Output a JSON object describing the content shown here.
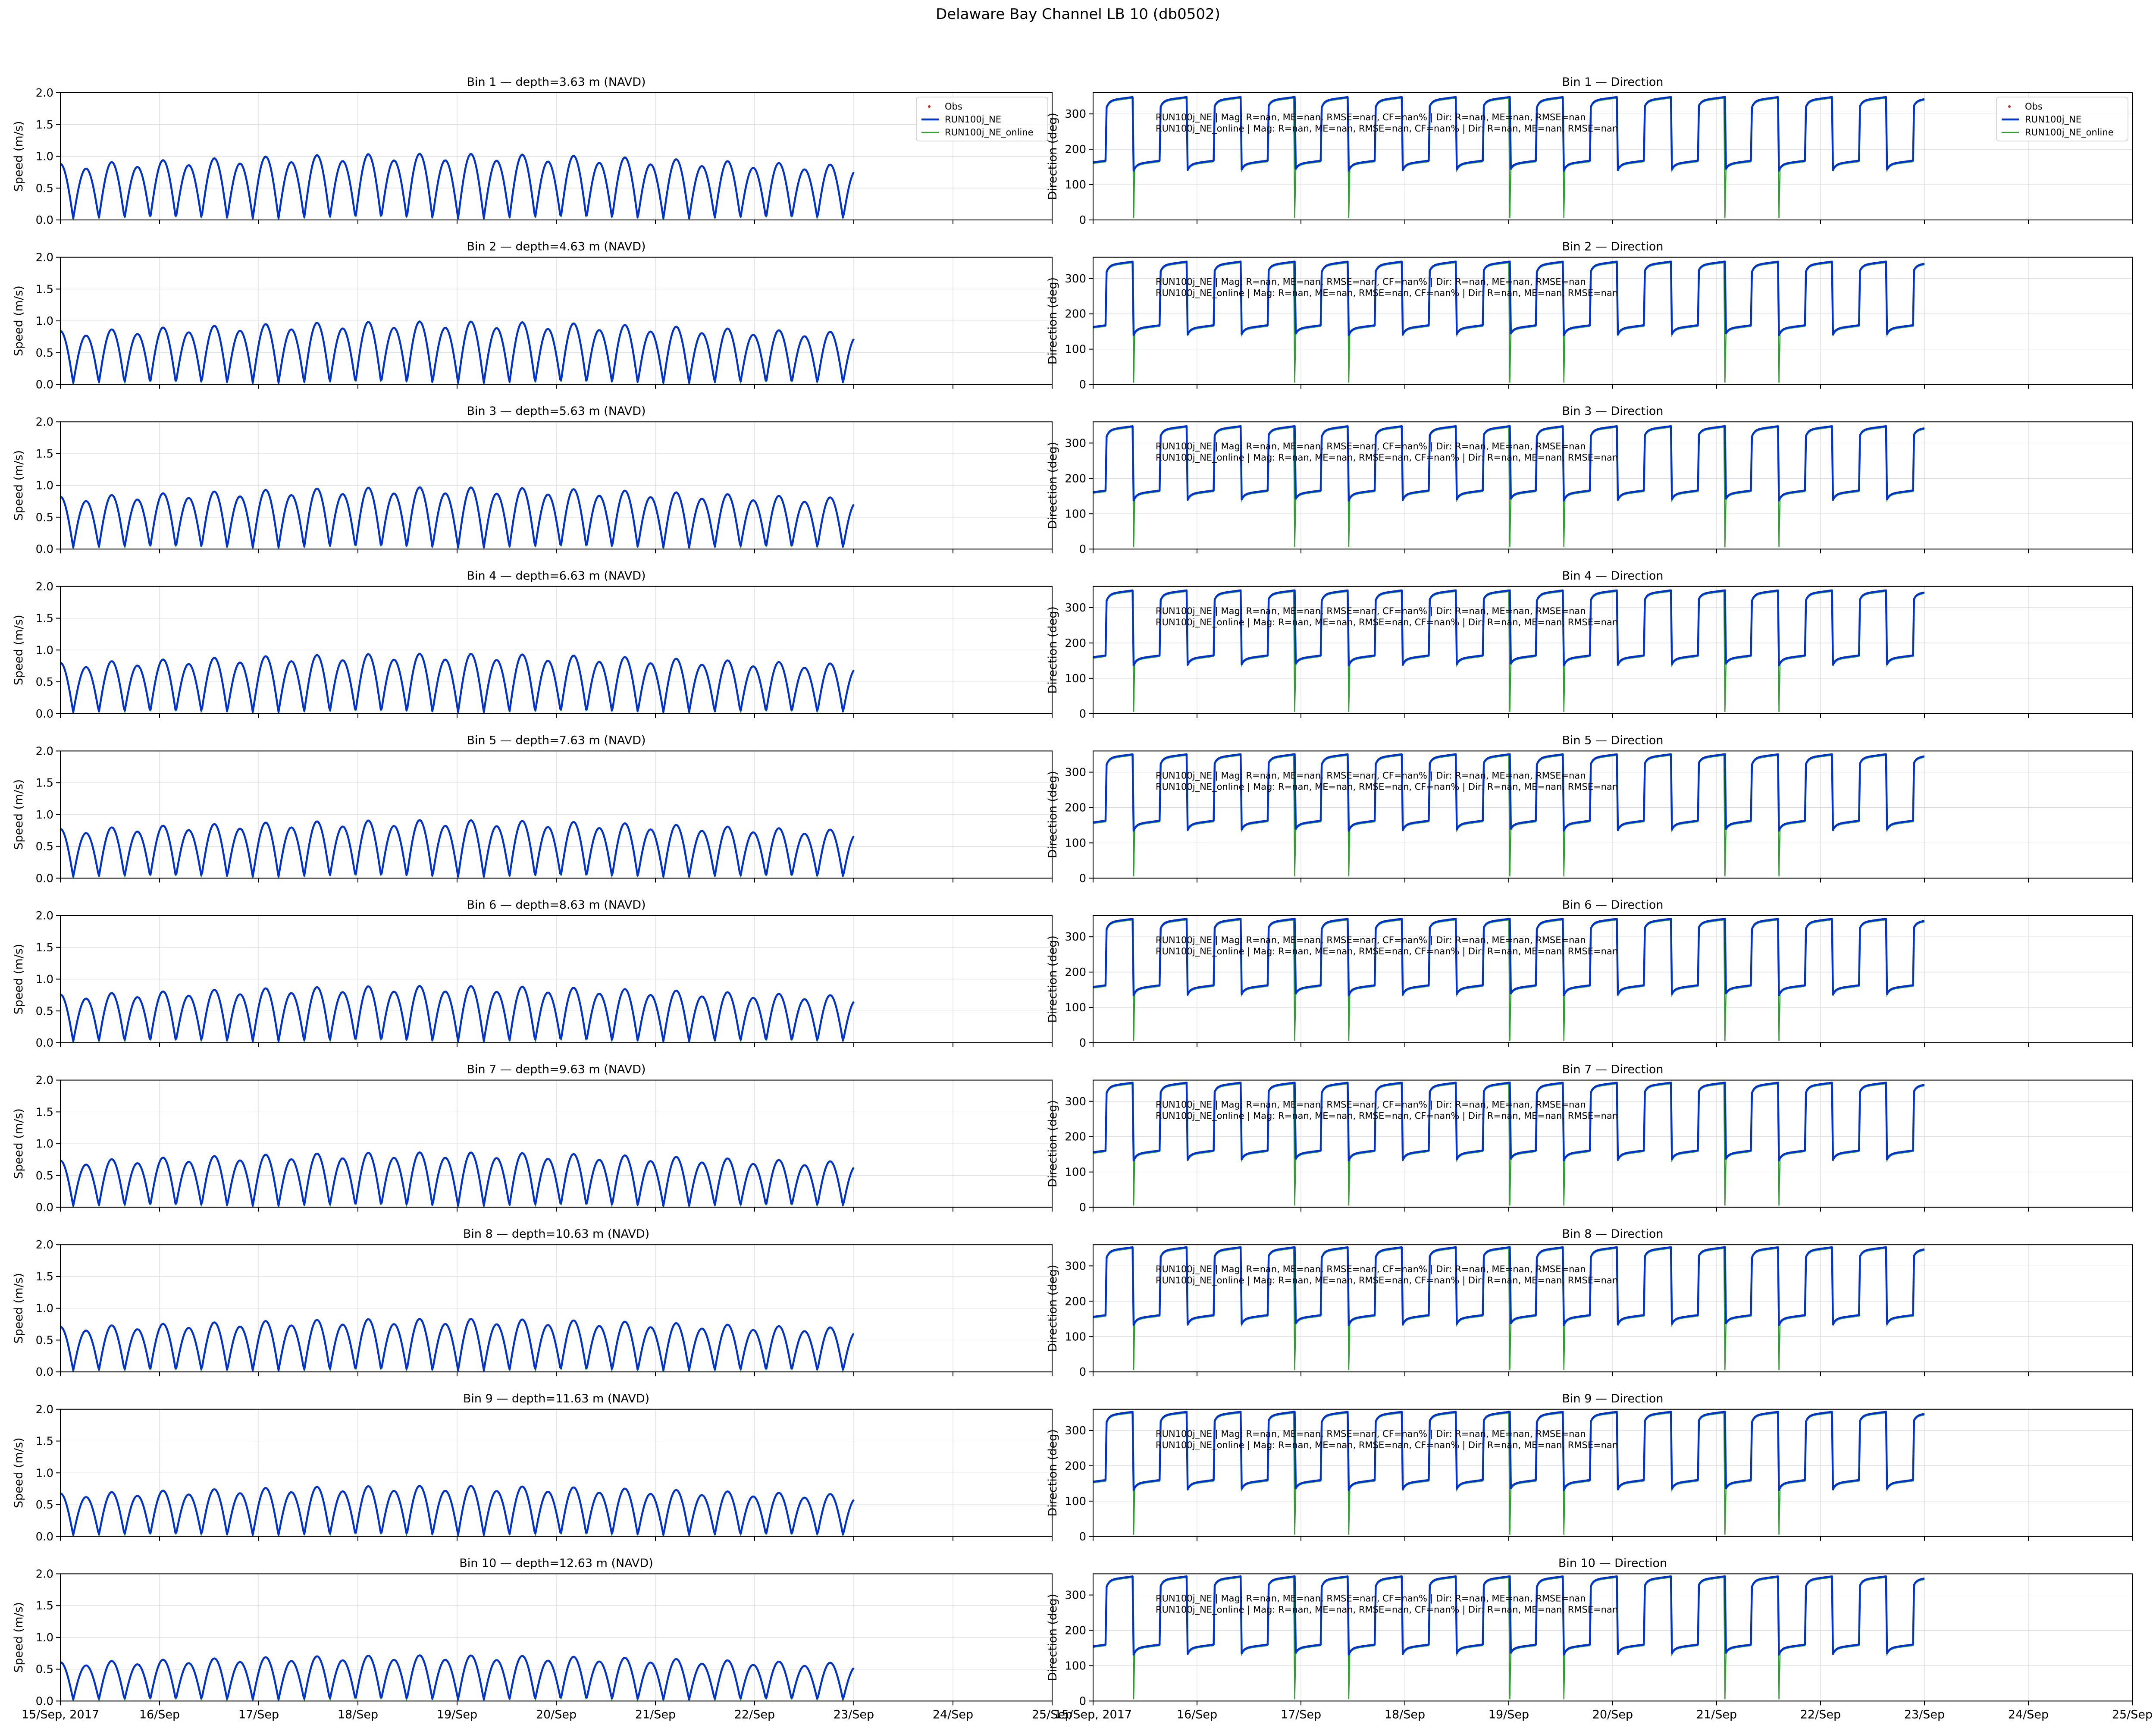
{
  "title": "Delaware Bay Channel LB 10 (db0502)",
  "colors": {
    "obs": "#d62728",
    "run_ne": "#0033cc",
    "run_ne_online": "#2ca02c",
    "grid": "#d9d9d9",
    "axis": "#000000"
  },
  "legend": {
    "obs": "Obs",
    "run_ne": "RUN100j_NE",
    "run_ne_online": "RUN100j_NE_online"
  },
  "stats": {
    "run_ne": "RUN100j_NE | Mag: R=nan, ME=nan, RMSE=nan, CF=nan% | Dir: R=nan, ME=nan, RMSE=nan",
    "run_ne_online": "RUN100j_NE_online | Mag: R=nan, ME=nan, RMSE=nan, CF=nan% | Dir: R=nan, ME=nan, RMSE=nan"
  },
  "chart_data": {
    "type": "line",
    "x_tick_labels": [
      "15/Sep, 2017",
      "16/Sep",
      "17/Sep",
      "18/Sep",
      "19/Sep",
      "20/Sep",
      "21/Sep",
      "22/Sep",
      "23/Sep",
      "24/Sep",
      "25/Sep"
    ],
    "x_range_days": [
      0,
      10
    ],
    "model_end_day": 8.0,
    "tidal_period_hours": 12.42,
    "speed_axis": {
      "label": "Speed (m/s)",
      "ylim": [
        0,
        2.0
      ],
      "ticks": [
        "0.0",
        "0.5",
        "1.0",
        "1.5",
        "2.0"
      ]
    },
    "direction_axis": {
      "label": "Direction (deg)",
      "ylim": [
        0,
        360
      ],
      "ticks": [
        "0",
        "100",
        "200",
        "300"
      ]
    },
    "grid": true,
    "legend_placement": "top-right",
    "bins": [
      {
        "speed_title": "Bin 1 — depth=3.63 m (NAVD)",
        "dir_title": "Bin 1 — Direction",
        "peak_speed": 1.05,
        "ebb_dir": 155,
        "flood_dir": 335
      },
      {
        "speed_title": "Bin 2 — depth=4.63 m (NAVD)",
        "dir_title": "Bin 2 — Direction",
        "peak_speed": 1.0,
        "ebb_dir": 155,
        "flood_dir": 335
      },
      {
        "speed_title": "Bin 3 — depth=5.63 m (NAVD)",
        "dir_title": "Bin 3 — Direction",
        "peak_speed": 0.98,
        "ebb_dir": 153,
        "flood_dir": 335
      },
      {
        "speed_title": "Bin 4 — depth=6.63 m (NAVD)",
        "dir_title": "Bin 4 — Direction",
        "peak_speed": 0.95,
        "ebb_dir": 152,
        "flood_dir": 336
      },
      {
        "speed_title": "Bin 5 — depth=7.63 m (NAVD)",
        "dir_title": "Bin 5 — Direction",
        "peak_speed": 0.92,
        "ebb_dir": 150,
        "flood_dir": 338
      },
      {
        "speed_title": "Bin 6 — depth=8.63 m (NAVD)",
        "dir_title": "Bin 6 — Direction",
        "peak_speed": 0.9,
        "ebb_dir": 150,
        "flood_dir": 338
      },
      {
        "speed_title": "Bin 7 — depth=9.63 m (NAVD)",
        "dir_title": "Bin 7 — Direction",
        "peak_speed": 0.87,
        "ebb_dir": 148,
        "flood_dir": 340
      },
      {
        "speed_title": "Bin 8 — depth=10.63 m (NAVD)",
        "dir_title": "Bin 8 — Direction",
        "peak_speed": 0.84,
        "ebb_dir": 148,
        "flood_dir": 340
      },
      {
        "speed_title": "Bin 9 — depth=11.63 m (NAVD)",
        "dir_title": "Bin 9 — Direction",
        "peak_speed": 0.8,
        "ebb_dir": 147,
        "flood_dir": 340
      },
      {
        "speed_title": "Bin 10 — depth=12.63 m (NAVD)",
        "dir_title": "Bin 10 — Direction",
        "peak_speed": 0.72,
        "ebb_dir": 147,
        "flood_dir": 340
      }
    ]
  }
}
